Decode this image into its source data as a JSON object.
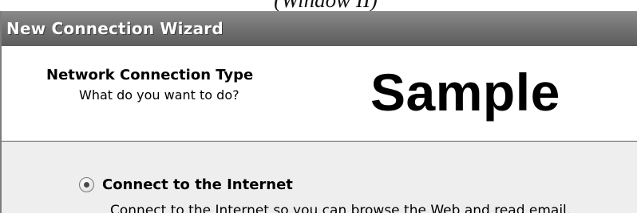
{
  "caption": "(Window II)",
  "window": {
    "title": "New Connection Wizard"
  },
  "header": {
    "title": "Network Connection Type",
    "subtitle": "What do you want to do?",
    "watermark": "Sample"
  },
  "options": [
    {
      "label": "Connect to the Internet",
      "description": "Connect to the Internet so you can browse the Web and read email.",
      "selected": true
    }
  ],
  "colors": {
    "titlebar": "#6f6f6f",
    "body_background": "#eeeeee"
  }
}
